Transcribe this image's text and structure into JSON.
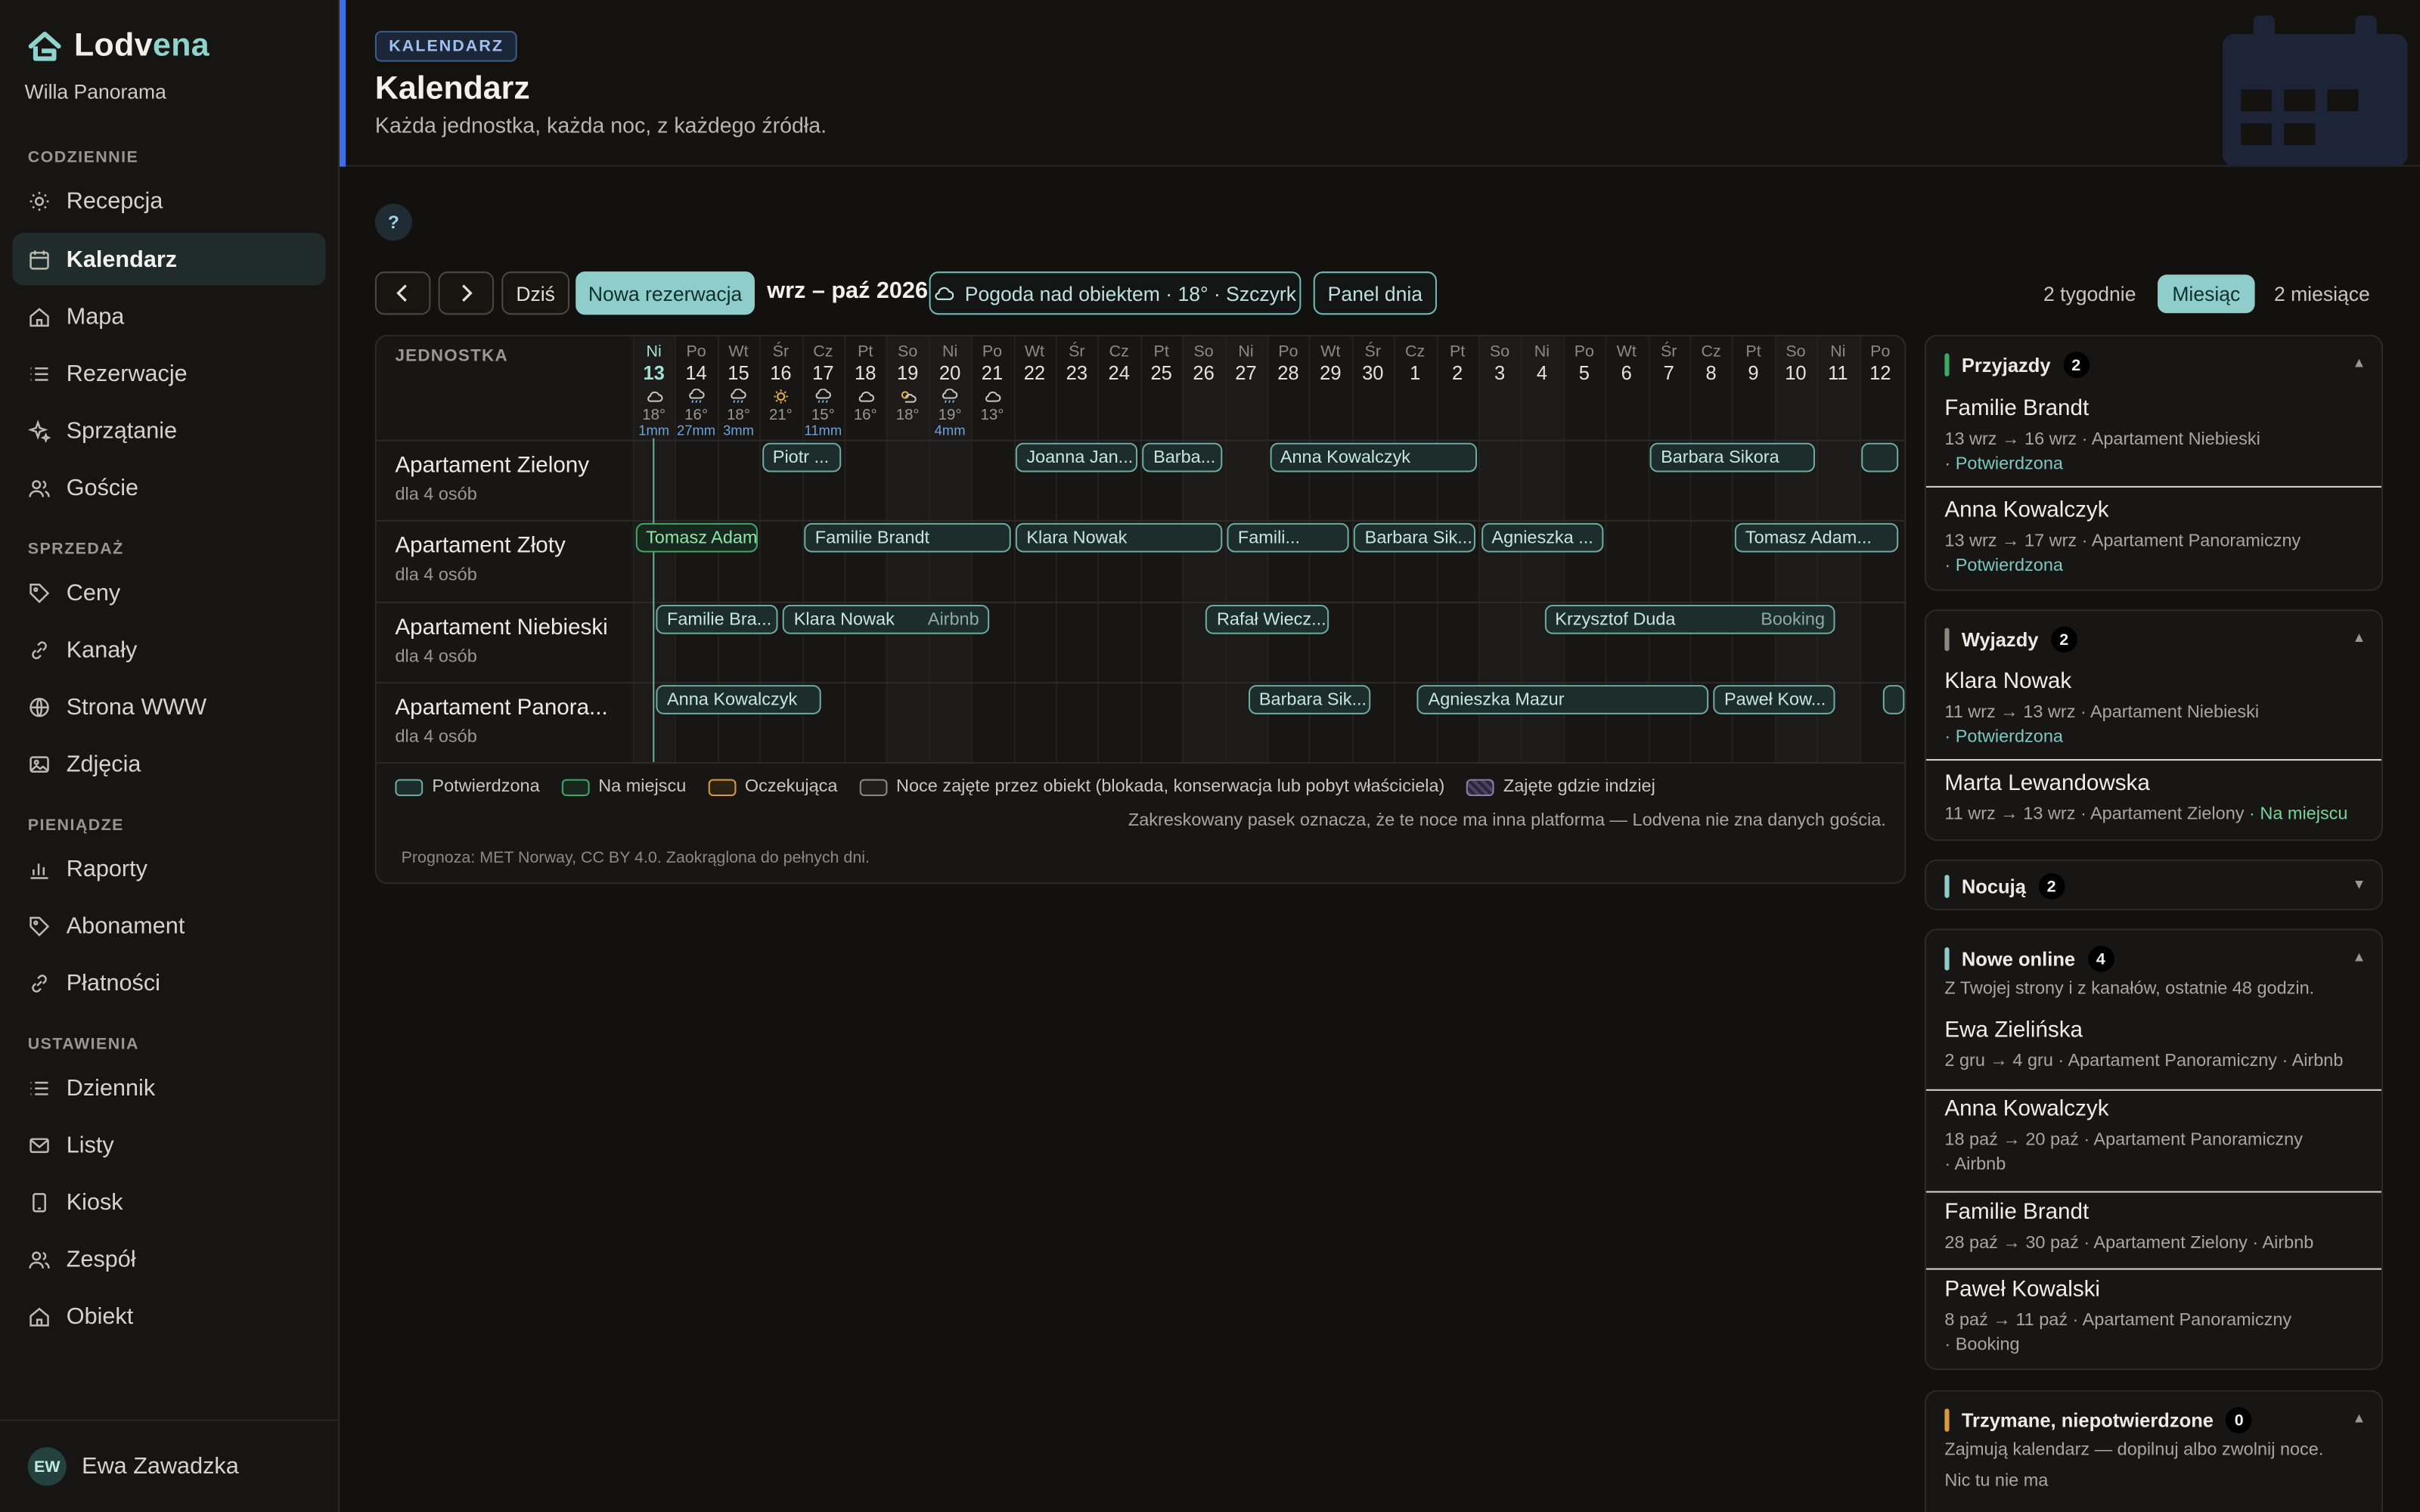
{
  "app": {
    "name_a": "Lodv",
    "name_b": "ena",
    "property": "Willa Panorama"
  },
  "nav": {
    "s1": "CODZIENNIE",
    "s2": "SPRZEDAŻ",
    "s3": "PIENIĄDZE",
    "s4": "USTAWIENIA",
    "items": [
      "Recepcja",
      "Kalendarz",
      "Mapa",
      "Rezerwacje",
      "Sprzątanie",
      "Goście",
      "Ceny",
      "Kanały",
      "Strona WWW",
      "Zdjęcia",
      "Raporty",
      "Abonament",
      "Płatności",
      "Dziennik",
      "Listy",
      "Kiosk",
      "Zespół",
      "Obiekt"
    ]
  },
  "user": {
    "initials": "EW",
    "name": "Ewa Zawadzka"
  },
  "header": {
    "badge": "KALENDARZ",
    "title": "Kalendarz",
    "subtitle": "Każda jednostka, każda noc, z każdego źródła."
  },
  "help": "?",
  "toolbar": {
    "prev": "‹",
    "next": "›",
    "today": "Dziś",
    "new": "Nowa rezerwacja",
    "range": "wrz – paź 2026",
    "weather": "Pogoda nad obiektem · 18° · Szczyrk",
    "panel": "Panel dnia"
  },
  "views": [
    "2 tygodnie",
    "Miesiąc",
    "2 miesiące"
  ],
  "grid": {
    "col_header": "JEDNOSTKA",
    "days": [
      {
        "n": "Ni",
        "d": "13",
        "t": "18°",
        "r": "1mm",
        "w": "cloud"
      },
      {
        "n": "Po",
        "d": "14",
        "t": "16°",
        "r": "27mm",
        "w": "rain"
      },
      {
        "n": "Wt",
        "d": "15",
        "t": "18°",
        "r": "3mm",
        "w": "rain"
      },
      {
        "n": "Śr",
        "d": "16",
        "t": "21°",
        "r": "",
        "w": "sun"
      },
      {
        "n": "Cz",
        "d": "17",
        "t": "15°",
        "r": "11mm",
        "w": "rain"
      },
      {
        "n": "Pt",
        "d": "18",
        "t": "16°",
        "r": "",
        "w": "cloud"
      },
      {
        "n": "So",
        "d": "19",
        "t": "18°",
        "r": "",
        "w": "partly"
      },
      {
        "n": "Ni",
        "d": "20",
        "t": "19°",
        "r": "4mm",
        "w": "rain"
      },
      {
        "n": "Po",
        "d": "21",
        "t": "13°",
        "r": "",
        "w": "cloud"
      },
      {
        "n": "Wt",
        "d": "22"
      },
      {
        "n": "Śr",
        "d": "23"
      },
      {
        "n": "Cz",
        "d": "24"
      },
      {
        "n": "Pt",
        "d": "25"
      },
      {
        "n": "So",
        "d": "26"
      },
      {
        "n": "Ni",
        "d": "27"
      },
      {
        "n": "Po",
        "d": "28"
      },
      {
        "n": "Wt",
        "d": "29"
      },
      {
        "n": "Śr",
        "d": "30"
      },
      {
        "n": "Cz",
        "d": "1"
      },
      {
        "n": "Pt",
        "d": "2"
      },
      {
        "n": "So",
        "d": "3"
      },
      {
        "n": "Ni",
        "d": "4"
      },
      {
        "n": "Po",
        "d": "5"
      },
      {
        "n": "Wt",
        "d": "6"
      },
      {
        "n": "Śr",
        "d": "7"
      },
      {
        "n": "Cz",
        "d": "8"
      },
      {
        "n": "Pt",
        "d": "9"
      },
      {
        "n": "So",
        "d": "10"
      },
      {
        "n": "Ni",
        "d": "11"
      },
      {
        "n": "Po",
        "d": "12"
      }
    ],
    "units": [
      {
        "name": "Apartament Zielony",
        "cap": "dla 4 osób"
      },
      {
        "name": "Apartament Złoty",
        "cap": "dla 4 osób"
      },
      {
        "name": "Apartament Niebieski",
        "cap": "dla 4 osób"
      },
      {
        "name": "Apartament Panora...",
        "cap": "dla 4 osób"
      }
    ],
    "bookings": [
      {
        "row": 0,
        "s": 3,
        "e": 5,
        "t": "Piotr ..."
      },
      {
        "row": 0,
        "s": 9,
        "e": 12,
        "t": "Joanna Jan..."
      },
      {
        "row": 0,
        "s": 12,
        "e": 14,
        "t": "Barba..."
      },
      {
        "row": 0,
        "s": 15,
        "e": 20,
        "t": "Anna Kowalczyk"
      },
      {
        "row": 0,
        "s": 24,
        "e": 28,
        "t": "Barbara Sikora"
      },
      {
        "row": 0,
        "s": 29,
        "e": 30,
        "t": ""
      },
      {
        "row": 1,
        "s": 0,
        "e": 3,
        "t": "Tomasz Adam...",
        "green": true
      },
      {
        "row": 1,
        "s": 4,
        "e": 9,
        "t": "Familie Brandt"
      },
      {
        "row": 1,
        "s": 9,
        "e": 14,
        "t": "Klara Nowak"
      },
      {
        "row": 1,
        "s": 14,
        "e": 17,
        "t": "Famili..."
      },
      {
        "row": 1,
        "s": 17,
        "e": 20,
        "t": "Barbara Sik..."
      },
      {
        "row": 1,
        "s": 20,
        "e": 23,
        "t": "Agnieszka ..."
      },
      {
        "row": 1,
        "s": 26,
        "e": 30,
        "t": "Tomasz Adam..."
      },
      {
        "row": 2,
        "s": 0.5,
        "e": 3.5,
        "t": "Familie Bra..."
      },
      {
        "row": 2,
        "s": 3.5,
        "e": 8.5,
        "t": "Klara Nowak",
        "ch": "Airbnb"
      },
      {
        "row": 2,
        "s": 13.5,
        "e": 16.5,
        "t": "Rafał Wiecz..."
      },
      {
        "row": 2,
        "s": 21.5,
        "e": 28.5,
        "t": "Krzysztof Duda",
        "ch": "Booking"
      },
      {
        "row": 3,
        "s": 0.5,
        "e": 4.5,
        "t": "Anna Kowalczyk"
      },
      {
        "row": 3,
        "s": 14.5,
        "e": 17.5,
        "t": "Barbara Sik..."
      },
      {
        "row": 3,
        "s": 18.5,
        "e": 25.5,
        "t": "Agnieszka Mazur"
      },
      {
        "row": 3,
        "s": 25.5,
        "e": 28.5,
        "t": "Paweł Kow..."
      },
      {
        "row": 3,
        "s": 29.5,
        "e": 30,
        "t": ""
      }
    ],
    "legend": {
      "confirmed": "Potwierdzona",
      "onsite": "Na miejscu",
      "pending": "Oczekująca",
      "blocked": "Noce zajęte przez obiekt  (blokada, konserwacja lub pobyt właściciela)",
      "elsewhere": "Zajęte gdzie indziej"
    },
    "legend_note": "Zakreskowany pasek oznacza, że te noce ma inna platforma — Lodvena nie zna danych gościa.",
    "forecast": "Prognoza: MET Norway, CC BY 4.0. Zaokrąglona do pełnych dni."
  },
  "colors": {
    "accent": "#8ecdc9",
    "confirmed": "#6ea9a2",
    "onsite": "#3fa865",
    "pending": "#d79a3c",
    "header_bar": "#3b6ee8"
  },
  "panels": {
    "arrivals": {
      "title": "Przyjazdy",
      "count": "2",
      "items": [
        {
          "name": "Familie Brandt",
          "meta": "13 wrz → 16 wrz  · Apartament Niebieski",
          "status": "· Potwierdzona"
        },
        {
          "name": "Anna Kowalczyk",
          "meta": "13 wrz → 17 wrz  · Apartament Panoramiczny",
          "status": "· Potwierdzona"
        }
      ]
    },
    "departures": {
      "title": "Wyjazdy",
      "count": "2",
      "items": [
        {
          "name": "Klara Nowak",
          "meta": "11 wrz → 13 wrz  · Apartament Niebieski",
          "status": "· Potwierdzona"
        },
        {
          "name": "Marta Lewandowska",
          "meta": "11 wrz → 13 wrz  · Apartament Zielony",
          "status": "· Na miejscu"
        }
      ]
    },
    "staying": {
      "title": "Nocują",
      "count": "2"
    },
    "online": {
      "title": "Nowe online",
      "count": "4",
      "note": "Z Twojej strony i z kanałów, ostatnie 48 godzin.",
      "items": [
        {
          "name": "Ewa Zielińska",
          "meta": "2 gru → 4 gru  · Apartament Panoramiczny  · Airbnb"
        },
        {
          "name": "Anna Kowalczyk",
          "meta": "18 paź → 20 paź  · Apartament Panoramiczny",
          "extra": "· Airbnb"
        },
        {
          "name": "Familie Brandt",
          "meta": "28 paź → 30 paź  · Apartament Zielony  · Airbnb"
        },
        {
          "name": "Paweł Kowalski",
          "meta": "8 paź → 11 paź  · Apartament Panoramiczny",
          "extra": "· Booking"
        }
      ]
    },
    "held": {
      "title": "Trzymane, niepotwierdzone",
      "count": "0",
      "note": "Zajmują kalendarz — dopilnuj albo zwolnij noce.",
      "empty": "Nic tu nie ma"
    }
  }
}
